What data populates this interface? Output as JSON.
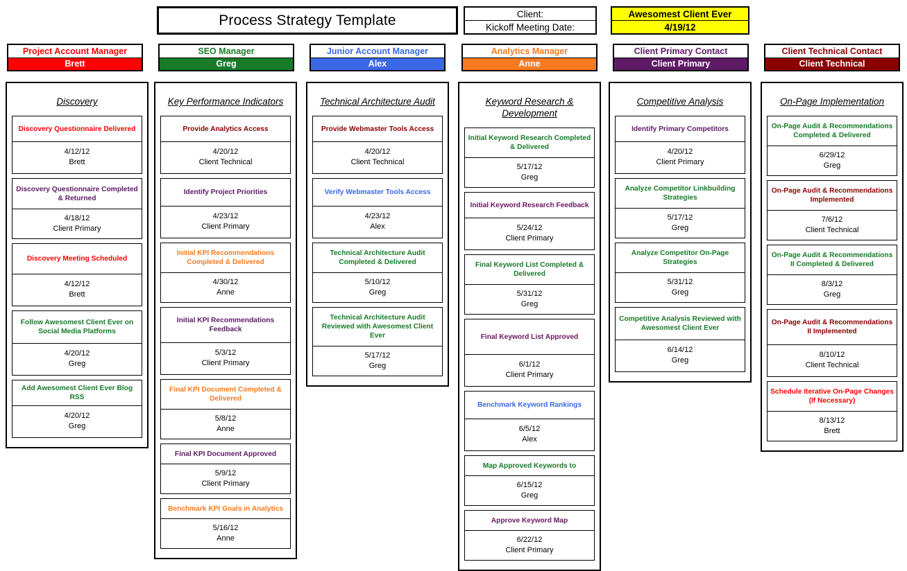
{
  "header": {
    "title": "Process Strategy Template",
    "client_label": "Client:",
    "kickoff_label": "Kickoff Meeting Date:",
    "client_name": "Awesomest Client Ever",
    "kickoff_date": "4/19/12"
  },
  "roles": [
    {
      "title": "Project Account Manager",
      "name": "Brett",
      "color": "#FF0000",
      "title_color": "#FF0000"
    },
    {
      "title": "SEO Manager",
      "name": "Greg",
      "color": "#177B28",
      "title_color": "#177B28"
    },
    {
      "title": "Junior Account Manager",
      "name": "Alex",
      "color": "#3A69E8",
      "title_color": "#3A69E8"
    },
    {
      "title": "Analytics Manager",
      "name": "Anne",
      "color": "#F97A20",
      "title_color": "#F97A20"
    },
    {
      "title": "Client Primary Contact",
      "name": "Client Primary",
      "color": "#5E1A66",
      "title_color": "#5E1A66"
    },
    {
      "title": "Client Technical Contact",
      "name": "Client Technical",
      "color": "#8B0000",
      "title_color": "#8B0000"
    }
  ],
  "columns": [
    {
      "title": "Discovery",
      "tasks": [
        {
          "name": "Discovery Questionnaire Delivered",
          "color": "#FF0000",
          "date": "4/12/12",
          "owner": "Brett",
          "name_h": 26,
          "meta_h": 38
        },
        {
          "name": "Discovery Questionnaire Completed & Returned",
          "color": "#5E1A66",
          "date": "4/18/12",
          "owner": "Client Primary",
          "name_h": 33,
          "meta_h": 35
        },
        {
          "name": "Discovery Meeting Scheduled",
          "color": "#FF0000",
          "date": "4/12/12",
          "owner": "Brett",
          "name_h": 33,
          "meta_h": 38
        },
        {
          "name": "Follow Awesomest Client Ever on Social Media Platforms",
          "color": "#177B28",
          "date": "4/20/12",
          "owner": "Greg",
          "name_h": 36,
          "meta_h": 38
        },
        {
          "name": "Add Awesomest Client Ever Blog RSS",
          "color": "#177B28",
          "date": "4/20/12",
          "owner": "Greg",
          "name_h": 26,
          "meta_h": 38
        }
      ]
    },
    {
      "title": "Key Performance Indicators",
      "tasks": [
        {
          "name": "Provide Analytics Access",
          "color": "#8B0000",
          "date": "4/20/12",
          "owner": "Client Technical",
          "name_h": 26,
          "meta_h": 38
        },
        {
          "name": "Identify Project Priorities",
          "color": "#5E1A66",
          "date": "4/23/12",
          "owner": "Client Primary",
          "name_h": 29,
          "meta_h": 38
        },
        {
          "name": "Initial KPI Recommendations Completed & Delivered",
          "color": "#F97A20",
          "date": "4/30/12",
          "owner": "Anne",
          "name_h": 32,
          "meta_h": 35
        },
        {
          "name": "Initial KPI Recommendations Feedback",
          "color": "#5E1A66",
          "date": "5/3/12",
          "owner": "Client Primary",
          "name_h": 40,
          "meta_h": 38
        },
        {
          "name": "Final KPI Document Completed & Delivered",
          "color": "#F97A20",
          "date": "5/8/12",
          "owner": "Anne",
          "name_h": 32,
          "meta_h": 35
        },
        {
          "name": "Final KPI Document Approved",
          "color": "#5E1A66",
          "date": "5/9/12",
          "owner": "Client Primary",
          "name_h": 18,
          "meta_h": 35
        },
        {
          "name": "Benchmark KPI Goals in Analytics",
          "color": "#F97A20",
          "date": "5/16/12",
          "owner": "Anne",
          "name_h": 18,
          "meta_h": 35
        }
      ]
    },
    {
      "title": "Technical Architecture Audit",
      "tasks": [
        {
          "name": "Provide Webmaster Tools Access",
          "color": "#8B0000",
          "date": "4/20/12",
          "owner": "Client Technical",
          "name_h": 26,
          "meta_h": 38
        },
        {
          "name": "Verify Webmaster Tools Access",
          "color": "#3A69E8",
          "date": "4/23/12",
          "owner": "Alex",
          "name_h": 29,
          "meta_h": 38
        },
        {
          "name": "Technical Architecture Audit Completed & Delivered",
          "color": "#177B28",
          "date": "5/10/12",
          "owner": "Greg",
          "name_h": 32,
          "meta_h": 35
        },
        {
          "name": "Technical Architecture Audit Reviewed with Awesomest Client Ever",
          "color": "#177B28",
          "date": "5/17/12",
          "owner": "Greg",
          "name_h": 45,
          "meta_h": 35
        }
      ]
    },
    {
      "title": "Keyword Research & Development",
      "tasks": [
        {
          "name": "Initial Keyword Research Completed & Delivered",
          "color": "#177B28",
          "date": "5/17/12",
          "owner": "Greg",
          "name_h": 32,
          "meta_h": 35
        },
        {
          "name": "Initial Keyword Research Feedback",
          "color": "#6B1560",
          "date": "5/24/12",
          "owner": "Client Primary",
          "name_h": 26,
          "meta_h": 38
        },
        {
          "name": "Final Keyword List Completed & Delivered",
          "color": "#177B28",
          "date": "5/31/12",
          "owner": "Greg",
          "name_h": 32,
          "meta_h": 35
        },
        {
          "name": "Final Keyword List Approved",
          "color": "#6B1560",
          "date": "6/1/12",
          "owner": "Client Primary",
          "name_h": 40,
          "meta_h": 38
        },
        {
          "name": "Benchmark Keyword Rankings",
          "color": "#3A69E8",
          "date": "6/5/12",
          "owner": "Alex",
          "name_h": 29,
          "meta_h": 38
        },
        {
          "name": "Map Approved Keywords to",
          "color": "#177B28",
          "date": "6/15/12",
          "owner": "Greg",
          "name_h": 18,
          "meta_h": 35
        },
        {
          "name": "Approve Keyword Map",
          "color": "#6B1560",
          "date": "6/22/12",
          "owner": "Client Primary",
          "name_h": 18,
          "meta_h": 35
        }
      ]
    },
    {
      "title": "Competitive Analysis",
      "tasks": [
        {
          "name": "Identify Primary Competitors",
          "color": "#5E1A66",
          "date": "4/20/12",
          "owner": "Client Primary",
          "name_h": 26,
          "meta_h": 38
        },
        {
          "name": "Analyze Competitor Linkbuilding Strategies",
          "color": "#177B28",
          "date": "5/17/12",
          "owner": "Greg",
          "name_h": 32,
          "meta_h": 35
        },
        {
          "name": "Analyze Competitor On-Page Strategies",
          "color": "#177B28",
          "date": "5/31/12",
          "owner": "Greg",
          "name_h": 32,
          "meta_h": 35
        },
        {
          "name": "Competitive Analysis Reviewed with Awesomest Client Ever",
          "color": "#177B28",
          "date": "6/14/12",
          "owner": "Greg",
          "name_h": 36,
          "meta_h": 38
        }
      ]
    },
    {
      "title": "On-Page Implementation",
      "tasks": [
        {
          "name": "On-Page Audit & Recommendations Completed & Delivered",
          "color": "#177B28",
          "date": "6/29/12",
          "owner": "Greg",
          "name_h": 32,
          "meta_h": 35
        },
        {
          "name": "On-Page Audit & Recommendations Implemented",
          "color": "#8B0000",
          "date": "7/6/12",
          "owner": "Client Technical",
          "name_h": 32,
          "meta_h": 35
        },
        {
          "name": "On-Page Audit & Recommendations II Completed & Delivered",
          "color": "#177B28",
          "date": "8/3/12",
          "owner": "Greg",
          "name_h": 32,
          "meta_h": 35
        },
        {
          "name": "On-Page Audit & Recommendations II Implemented",
          "color": "#8B0000",
          "date": "8/10/12",
          "owner": "Client Technical",
          "name_h": 40,
          "meta_h": 38
        },
        {
          "name": "Schedule Iterative On-Page Changes (If Necessary)",
          "color": "#FF0000",
          "date": "8/13/12",
          "owner": "Brett",
          "name_h": 32,
          "meta_h": 35
        }
      ]
    }
  ],
  "layout": {
    "column_lefts": [
      8,
      222,
      441,
      660,
      877,
      1096
    ],
    "role_lefts": [
      10,
      228,
      446,
      665,
      883,
      1101
    ]
  }
}
